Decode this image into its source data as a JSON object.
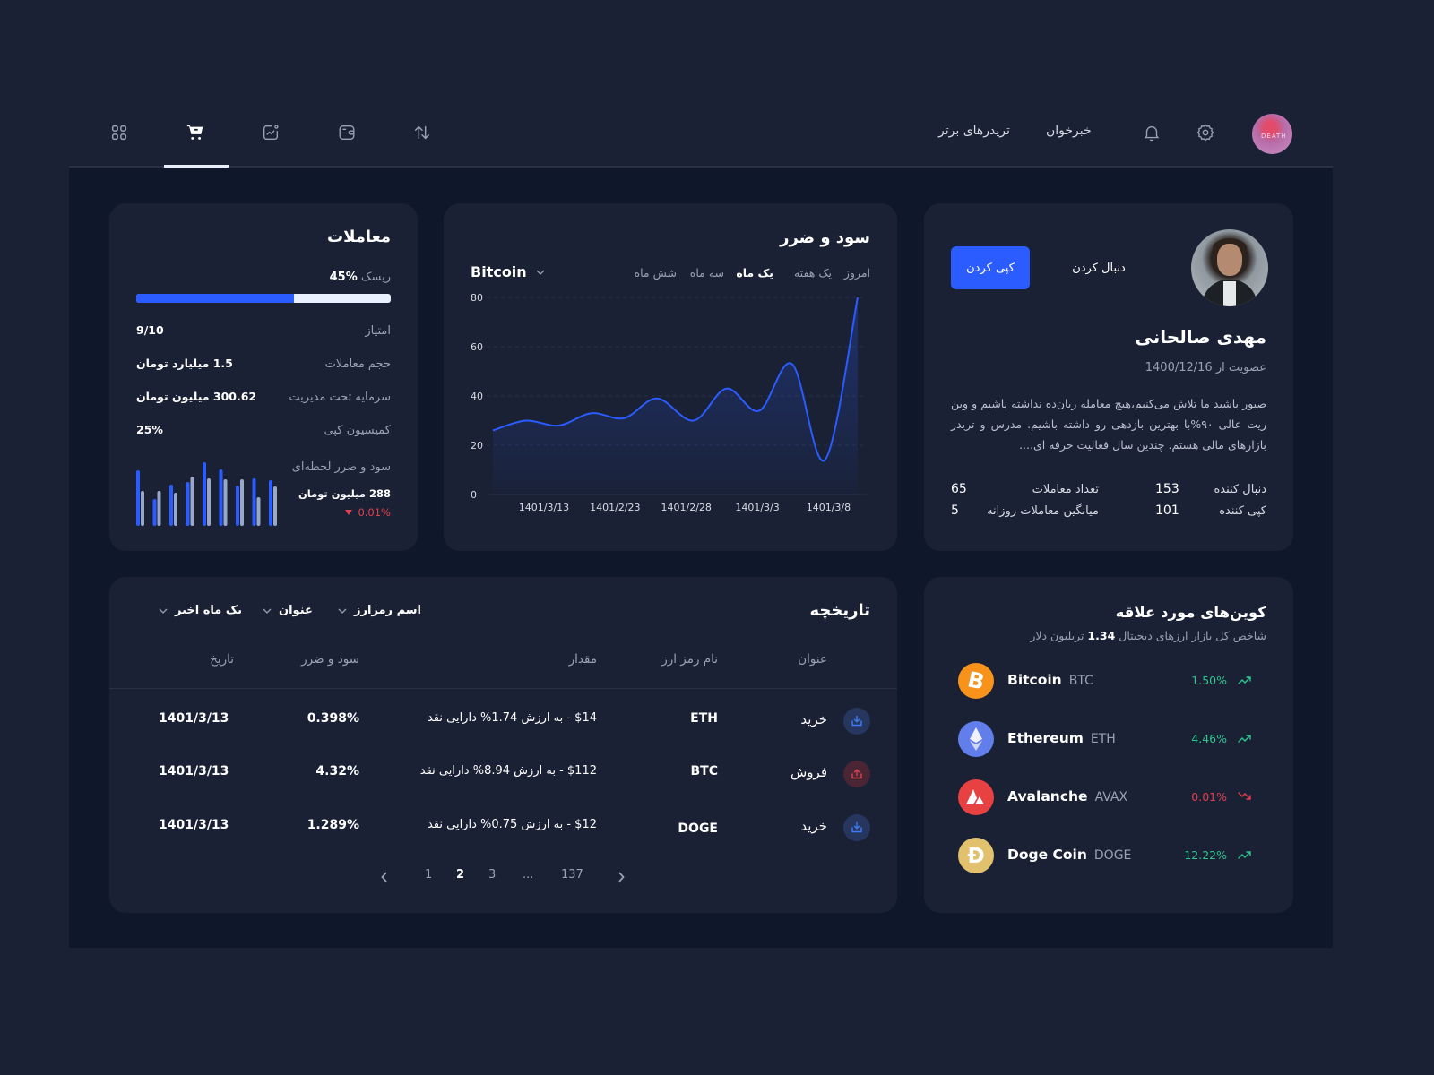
{
  "topbar": {
    "nav_icons": [
      "apps-grid-icon",
      "cart-icon",
      "analytics-icon",
      "wallet-icon",
      "swap-arrows-icon"
    ],
    "active_nav": "cart-icon",
    "links": [
      "خبرخوان",
      "تریدرهای برتر"
    ],
    "avatar_text": "DEATH"
  },
  "profile": {
    "name": "مهدی صالحانی",
    "member_since_label": "عضویت از",
    "member_since": "1400/12/16",
    "bio": "صبور باشید ما تلاش می‌کنیم،هیچ معامله زیان‌ده نداشته باشیم و وین ریت عالی ۹۰%با بهترین بازدهی رو داشته باشیم. مدرس و تریدر بازارهای مالی هستم. چندین سال فعالیت حرفه ای....",
    "copy_button": "کپی کردن",
    "follow_button": "دنبال کردن",
    "stats": [
      {
        "label": "دنبال کننده",
        "value": "153"
      },
      {
        "label": "کپی کننده",
        "value": "101"
      },
      {
        "label": "تعداد معاملات",
        "value": "65"
      },
      {
        "label": "میانگین معاملات روزانه",
        "value": "5"
      }
    ]
  },
  "pnl_chart_card": {
    "title": "سود و ضرر",
    "tabs": [
      "امروز",
      "یک هفته",
      "یک ماه",
      "سه ماه",
      "شش ماه"
    ],
    "active_tab": "یک ماه",
    "asset_select": "Bitcoin"
  },
  "chart_data": {
    "type": "area",
    "title": "سود و ضرر",
    "xlabel": "",
    "ylabel": "",
    "ylim": [
      0,
      80
    ],
    "yticks": [
      0,
      20,
      40,
      60,
      80
    ],
    "x_tick_labels": [
      "1401/3/13",
      "1401/2/23",
      "1401/2/28",
      "1401/3/3",
      "1401/3/8"
    ],
    "grid": true,
    "series": [
      {
        "name": "Bitcoin",
        "color": "#2a5cff",
        "points": [
          [
            0,
            26
          ],
          [
            0.09,
            30
          ],
          [
            0.18,
            28
          ],
          [
            0.27,
            33
          ],
          [
            0.36,
            31
          ],
          [
            0.45,
            39
          ],
          [
            0.55,
            30
          ],
          [
            0.64,
            43
          ],
          [
            0.73,
            34
          ],
          [
            0.82,
            53
          ],
          [
            0.91,
            14
          ],
          [
            1.0,
            80
          ]
        ]
      }
    ]
  },
  "trades_card": {
    "title": "معاملات",
    "risk_label": "ریسک",
    "risk_value": "%45",
    "risk_fill_percent": 62,
    "rows": [
      {
        "label": "امتیاز",
        "value": "9/10"
      },
      {
        "label": "حجم معاملات",
        "value": "1.5 میلیارد تومان"
      },
      {
        "label": "سرمایه تحت مدیریت",
        "value": "300.62 میلیون تومان"
      },
      {
        "label": "کمیسیون کپی",
        "value": "25%"
      }
    ],
    "instant_pnl_label": "سود و ضرر لحظه‌ای",
    "instant_pnl_value": "288 میلیون تومان",
    "instant_pnl_change": "0.01%",
    "mini_bars": [
      [
        62,
        39
      ],
      [
        30,
        39
      ],
      [
        46,
        37
      ],
      [
        49,
        55
      ],
      [
        71,
        53
      ],
      [
        63,
        52
      ],
      [
        45,
        52
      ],
      [
        53,
        32
      ],
      [
        51,
        44
      ]
    ]
  },
  "history": {
    "title": "تاریخچه",
    "filters": [
      "اسم رمزارز",
      "عنوان",
      "یک ماه اخیر"
    ],
    "columns": [
      "عنوان",
      "نام رمز ارز",
      "مقدار",
      "سود و ضرر",
      "تاریخ"
    ],
    "rows": [
      {
        "type": "buy",
        "title": "خرید",
        "symbol": "ETH",
        "amount": "$14 - به ارزش 1.74% دارایی نقد",
        "pnl": "0.398%",
        "date": "1401/3/13"
      },
      {
        "type": "sell",
        "title": "فروش",
        "symbol": "BTC",
        "amount": "$112 - به ارزش 8.94% دارایی نقد",
        "pnl": "4.32%",
        "date": "1401/3/13"
      },
      {
        "type": "buy",
        "title": "خرید",
        "symbol": "DOGE",
        "amount": "$12 - به ارزش 0.75% دارایی نقد",
        "pnl": "1.289%",
        "date": "1401/3/13"
      }
    ],
    "pagination": {
      "pages": [
        "1",
        "2",
        "3",
        "...",
        "137"
      ],
      "active": "2"
    }
  },
  "favorites": {
    "title": "کوین‌های مورد علاقه",
    "subtitle_prefix": "شاخص کل بازار ارزهای دیجیتال",
    "subtitle_value": "1.34",
    "subtitle_suffix": "تریلیون دلار",
    "coins": [
      {
        "name": "Bitcoin",
        "symbol": "BTC",
        "change": "1.50%",
        "trend": "up",
        "color": "#f7931a"
      },
      {
        "name": "Ethereum",
        "symbol": "ETH",
        "change": "4.46%",
        "trend": "up",
        "color": "#627eea"
      },
      {
        "name": "Avalanche",
        "symbol": "AVAX",
        "change": "0.01%",
        "trend": "down",
        "color": "#e84142"
      },
      {
        "name": "Doge Coin",
        "symbol": "DOGE",
        "change": "12.22%",
        "trend": "up",
        "color": "#e1c16e"
      }
    ]
  },
  "colors": {
    "accent": "#2a5cff",
    "positive": "#2fc48d",
    "negative": "#e0404e"
  }
}
